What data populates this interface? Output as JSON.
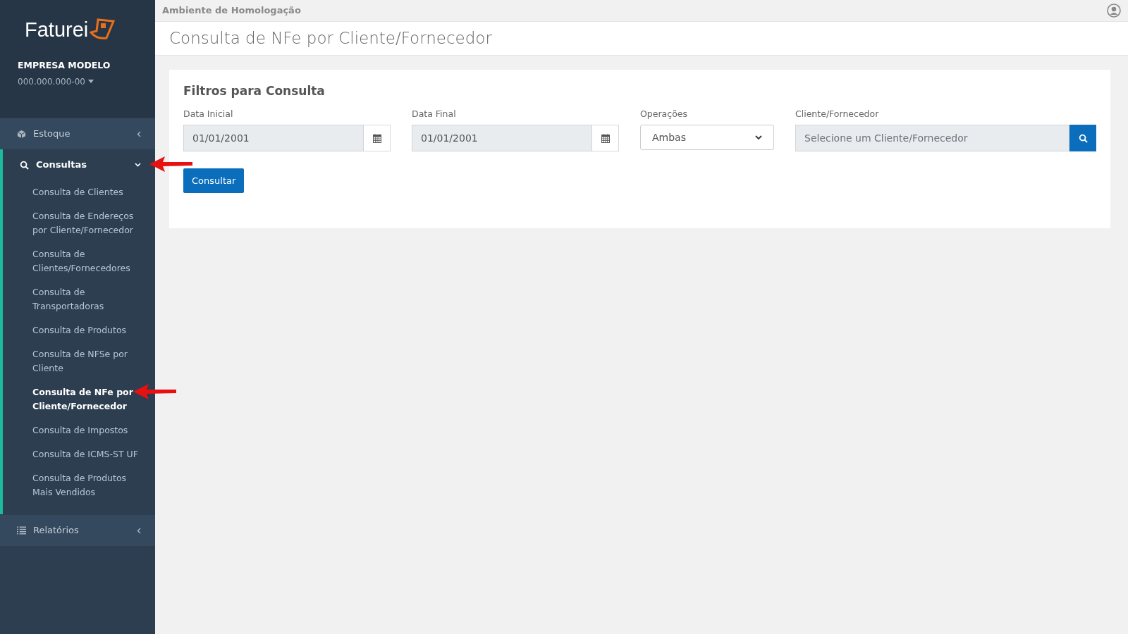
{
  "sidebar": {
    "logo": "Faturei",
    "company": "EMPRESA MODELO",
    "document": "000.000.000-00",
    "items": [
      {
        "label": "Estoque",
        "expanded": false
      },
      {
        "label": "Consultas",
        "expanded": true,
        "children": [
          {
            "label": "Consulta de Clientes",
            "selected": false
          },
          {
            "label": "Consulta de Endereços por Cliente/Fornecedor",
            "selected": false
          },
          {
            "label": "Consulta de Clientes/Fornecedores",
            "selected": false
          },
          {
            "label": "Consulta de Transportadoras",
            "selected": false
          },
          {
            "label": "Consulta de Produtos",
            "selected": false
          },
          {
            "label": "Consulta de NFSe por Cliente",
            "selected": false
          },
          {
            "label": "Consulta de NFe por Cliente/Fornecedor",
            "selected": true
          },
          {
            "label": "Consulta de Impostos",
            "selected": false
          },
          {
            "label": "Consulta de ICMS-ST UF",
            "selected": false
          },
          {
            "label": "Consulta de Produtos Mais Vendidos",
            "selected": false
          }
        ]
      },
      {
        "label": "Relatórios",
        "expanded": false
      }
    ]
  },
  "topbar": {
    "environment": "Ambiente de Homologação"
  },
  "page_title": "Consulta de NFe por Cliente/Fornecedor",
  "filters": {
    "title": "Filtros para Consulta",
    "fields": [
      {
        "kind": "date",
        "label": "Data Inicial",
        "value": "01/01/2001"
      },
      {
        "kind": "date",
        "label": "Data Final",
        "value": "01/01/2001"
      },
      {
        "kind": "select",
        "label": "Operações",
        "value": "Ambas"
      },
      {
        "kind": "lookup",
        "label": "Cliente/Fornecedor",
        "placeholder": "Selecione um Cliente/Fornecedor"
      }
    ],
    "button": "Consultar"
  }
}
